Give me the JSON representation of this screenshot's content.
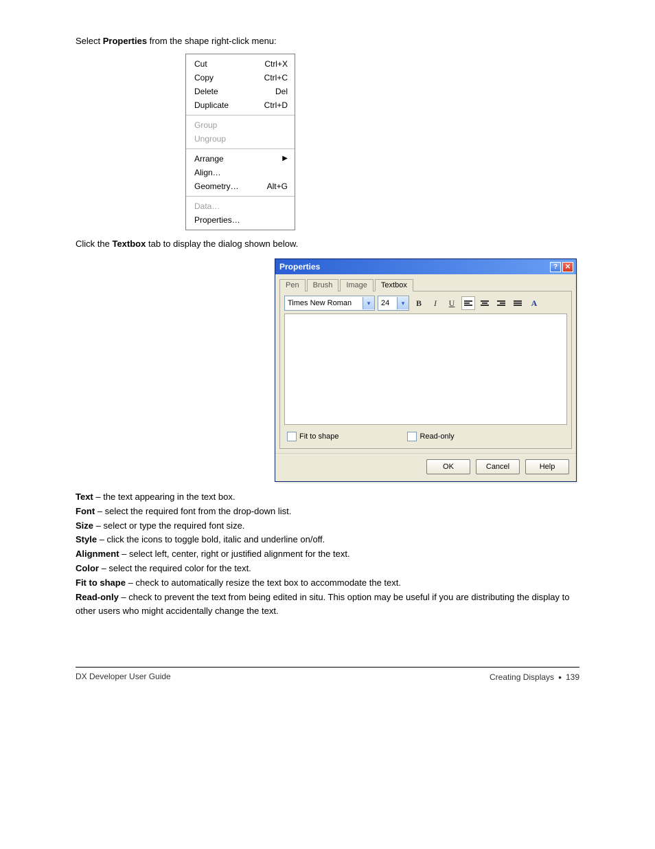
{
  "intro_pre": "Select ",
  "intro_bold": "Properties",
  "intro_post": " from the shape right-click menu:",
  "context_menu": {
    "section1": [
      {
        "label": "Cut",
        "accel": "Ctrl+X",
        "disabled": false
      },
      {
        "label": "Copy",
        "accel": "Ctrl+C",
        "disabled": false
      },
      {
        "label": "Delete",
        "accel": "Del",
        "disabled": false
      },
      {
        "label": "Duplicate",
        "accel": "Ctrl+D",
        "disabled": false
      }
    ],
    "section2": [
      {
        "label": "Group",
        "accel": "",
        "disabled": true
      },
      {
        "label": "Ungroup",
        "accel": "",
        "disabled": true
      }
    ],
    "section3": [
      {
        "label": "Arrange",
        "accel": "",
        "submenu": true,
        "disabled": false
      },
      {
        "label": "Align…",
        "accel": "",
        "disabled": false
      },
      {
        "label": "Geometry…",
        "accel": "Alt+G",
        "disabled": false
      }
    ],
    "section4": [
      {
        "label": "Data…",
        "accel": "",
        "disabled": true
      },
      {
        "label": "Properties…",
        "accel": "",
        "disabled": false
      }
    ]
  },
  "body_para_pre": "Click the ",
  "body_para_bold": "Textbox",
  "body_para_post": " tab to display the dialog shown below.",
  "dialog": {
    "title": "Properties",
    "tabs": [
      "Pen",
      "Brush",
      "Image",
      "Textbox"
    ],
    "active_tab_index": 3,
    "font_name": "Times New Roman",
    "font_size": "24",
    "checkbox1": "Fit to shape",
    "checkbox2": "Read-only",
    "buttons": {
      "ok": "OK",
      "cancel": "Cancel",
      "help": "Help"
    }
  },
  "after": [
    {
      "label": "Text",
      "desc": " – the text appearing in the text box."
    },
    {
      "label": "Font",
      "desc": " – select the required font from the drop-down list."
    },
    {
      "label": "Size",
      "desc": " – select or type the required font size."
    },
    {
      "label": "Style",
      "desc": " – click the icons to toggle bold, italic and underline on/off."
    },
    {
      "label": "Alignment",
      "desc": " – select left, center, right or justified alignment for the text."
    },
    {
      "label": "Color",
      "desc": " – select the required color for the text."
    },
    {
      "label": "Fit to shape",
      "desc": " – check to automatically resize the text box to accommodate the text."
    },
    {
      "label": "Read-only",
      "desc": " – check to prevent the text from being edited in situ. This option may be useful if you are distributing the display to other users who might accidentally change the text."
    }
  ],
  "footer": {
    "left": "DX Developer User Guide",
    "right_text": "Creating Displays ",
    "right_dot": "•",
    "page": " 139"
  }
}
